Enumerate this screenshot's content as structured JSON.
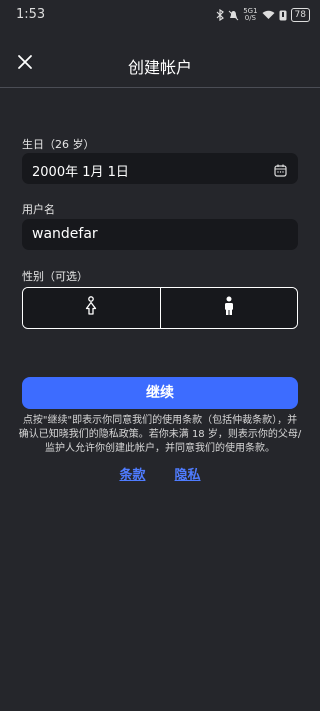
{
  "status_bar": {
    "time": "1:53",
    "network_top": "5G1",
    "network_bottom": "0/S",
    "battery": "78"
  },
  "app_bar": {
    "close_icon": "close-icon",
    "title": "创建帐户"
  },
  "birthday": {
    "label": "生日（26 岁）",
    "value": "2000年 1月 1日",
    "icon": "calendar-icon"
  },
  "username": {
    "label": "用户名",
    "value": "wandefar"
  },
  "gender": {
    "label": "性别（可选）",
    "options": [
      {
        "icon": "female-icon"
      },
      {
        "icon": "male-icon"
      }
    ]
  },
  "continue_button": {
    "label": "继续"
  },
  "terms": {
    "text": "点按\"继续\"即表示你同意我们的使用条款（包括仲裁条款），并确认已知晓我们的隐私政策。若你未满 18 岁，则表示你的父母/监护人允许你创建此帐户，并同意我们的使用条款。",
    "terms_link": "条款",
    "privacy_link": "隐私"
  },
  "colors": {
    "background": "#25262b",
    "field_bg": "#17181c",
    "accent": "#3d6cff",
    "link": "#4f7cff"
  }
}
